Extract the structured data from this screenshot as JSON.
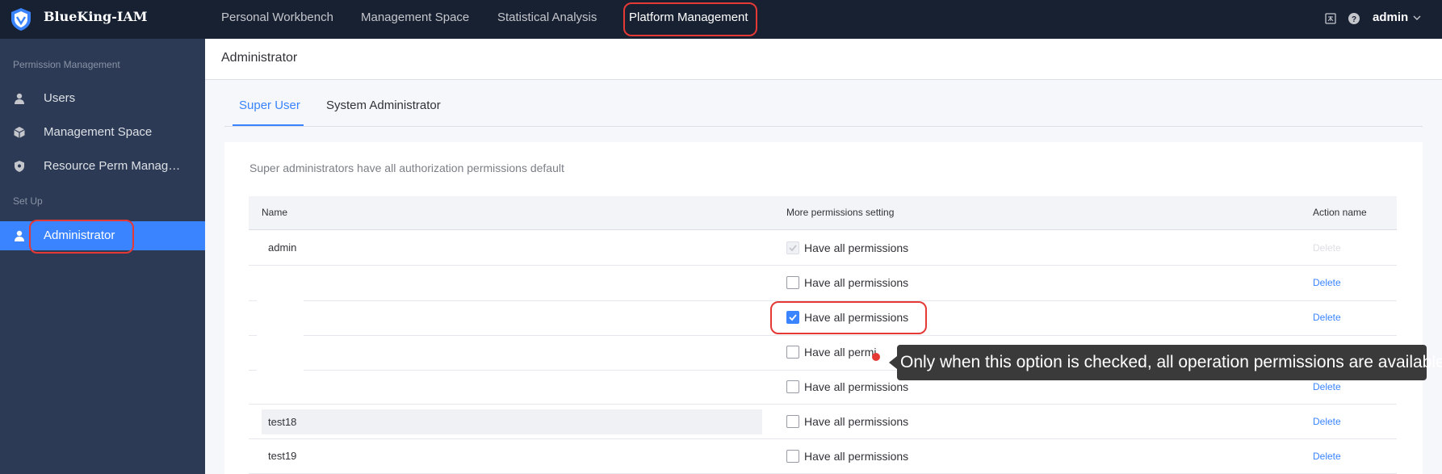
{
  "app": {
    "brand": "BlueKing-IAM"
  },
  "topnav": {
    "items": [
      {
        "label": "Personal Workbench"
      },
      {
        "label": "Management Space"
      },
      {
        "label": "Statistical Analysis"
      },
      {
        "label": "Platform Management"
      }
    ],
    "active_index": 3,
    "user": "admin"
  },
  "sidebar": {
    "groups": [
      {
        "title": "Permission Management"
      },
      {
        "title": "Set Up"
      }
    ],
    "items": [
      {
        "label": "Users",
        "icon": "user-icon"
      },
      {
        "label": "Management Space",
        "icon": "cube-icon"
      },
      {
        "label": "Resource Perm Manag…",
        "icon": "shield-icon"
      },
      {
        "label": "Administrator",
        "icon": "user-icon",
        "active": true
      }
    ]
  },
  "page": {
    "title": "Administrator",
    "tabs": [
      {
        "label": "Super User",
        "active": true
      },
      {
        "label": "System Administrator"
      }
    ],
    "description": "Super administrators have all authorization permissions default"
  },
  "table": {
    "columns": [
      "Name",
      "More permissions setting",
      "Action name"
    ],
    "rows": [
      {
        "name": "admin",
        "permission": "Have all permissions",
        "checked": true,
        "disabled": true,
        "action": "Delete"
      },
      {
        "name": "",
        "permission": "Have all permissions",
        "checked": false,
        "disabled": false,
        "action": "Delete"
      },
      {
        "name": "",
        "permission": "Have all permissions",
        "checked": true,
        "disabled": false,
        "action": "Delete"
      },
      {
        "name": "",
        "permission": "Have all permi",
        "checked": false,
        "disabled": false,
        "action": ""
      },
      {
        "name": "",
        "permission": "Have all permissions",
        "checked": false,
        "disabled": false,
        "action": "Delete"
      },
      {
        "name": "test18",
        "permission": "Have all permissions",
        "checked": false,
        "disabled": false,
        "action": "Delete"
      },
      {
        "name": "test19",
        "permission": "Have all permissions",
        "checked": false,
        "disabled": false,
        "action": "Delete"
      }
    ]
  },
  "tooltip": {
    "text": "Only when this option is checked, all operation permissions are available"
  },
  "colors": {
    "primary": "#3a84ff",
    "topbar": "#182132",
    "sidebar": "#2c3a55",
    "highlight": "#e53935"
  }
}
